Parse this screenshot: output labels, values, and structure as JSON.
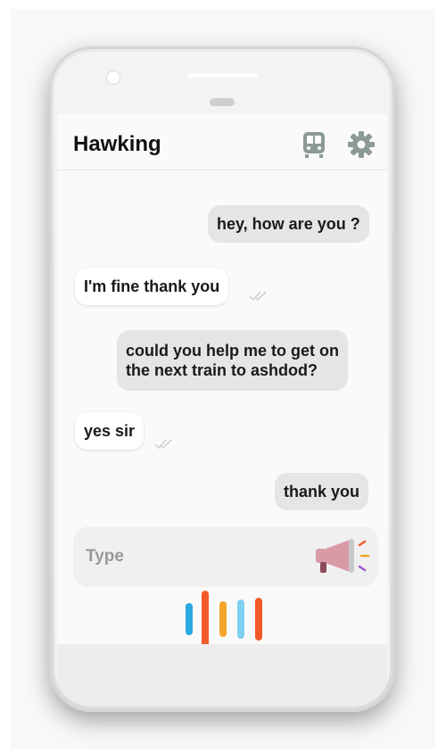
{
  "app": {
    "title": "Hawking"
  },
  "header": {
    "icons": [
      "train-icon",
      "gear-icon"
    ],
    "icon_color": "#8b9a94"
  },
  "messages": [
    {
      "sender": "user",
      "text": "hey, how are you ?"
    },
    {
      "sender": "bot",
      "text": "I'm fine thank you",
      "status": "read"
    },
    {
      "sender": "user",
      "lines": [
        "could you help me to get on",
        "the next train to ashdod?"
      ]
    },
    {
      "sender": "bot",
      "text": "yes sir",
      "status": "read"
    },
    {
      "sender": "user",
      "text": "thank you"
    }
  ],
  "composer": {
    "placeholder": "Type",
    "mic_icon": "megaphone-icon"
  },
  "voice_wave": {
    "colors": [
      "#29a9e0",
      "#f25a2a",
      "#f4a62a",
      "#7dd0f0",
      "#f25a2a"
    ]
  },
  "colors": {
    "user_bubble": "#e5e5e5",
    "bot_bubble": "#ffffff",
    "megaphone_body": "#d99aa8"
  }
}
